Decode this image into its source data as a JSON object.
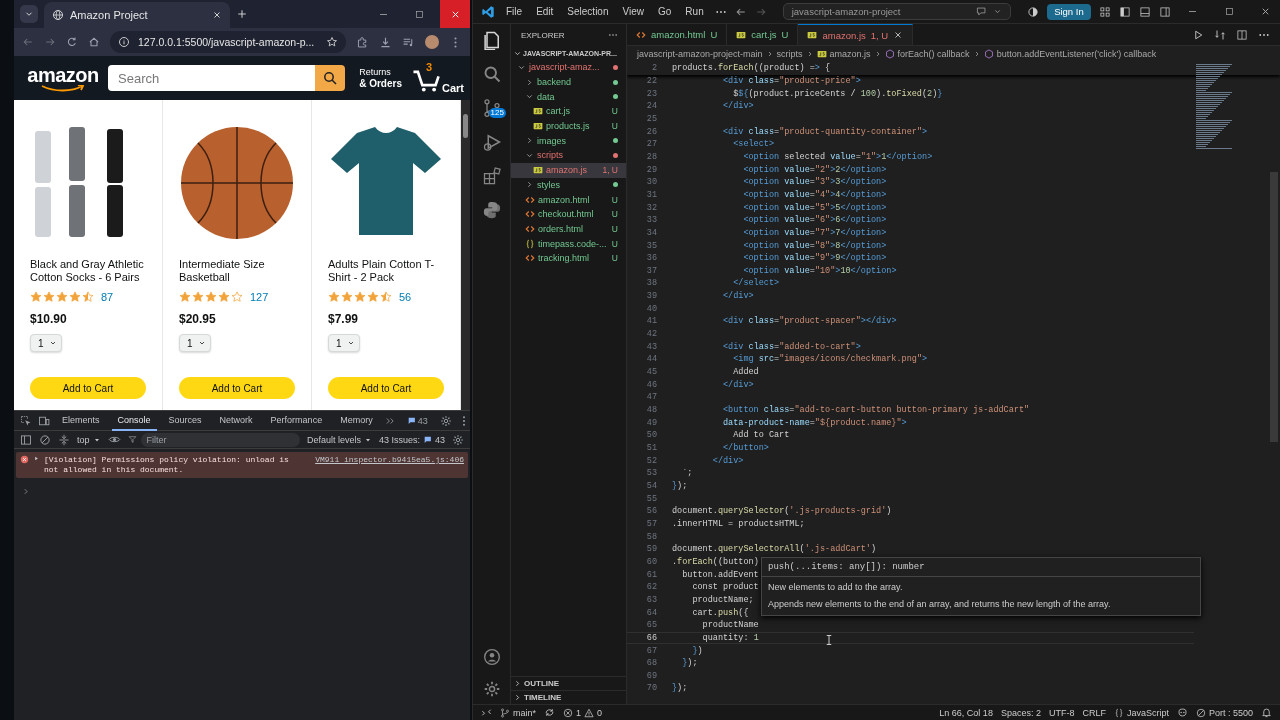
{
  "browser": {
    "tab": {
      "title": "Amazon Project"
    },
    "address": "127.0.0.1:5500/javascript-amazon-p...",
    "site": {
      "logo": "amazon",
      "search": {
        "placeholder": "Search"
      },
      "returns": "Returns",
      "orders": "& Orders",
      "cart_count": "3",
      "cart": "Cart",
      "products": [
        {
          "name": "Black and Gray Athletic Cotton Socks - 6 Pairs",
          "stars": 4.5,
          "rating_count": "87",
          "price": "$10.90",
          "quantity": "1",
          "button": "Add to Cart"
        },
        {
          "name": "Intermediate Size Basketball",
          "stars": 4,
          "rating_count": "127",
          "price": "$20.95",
          "quantity": "1",
          "button": "Add to Cart"
        },
        {
          "name": "Adults Plain Cotton T-Shirt - 2 Pack",
          "stars": 4.5,
          "rating_count": "56",
          "price": "$7.99",
          "quantity": "1",
          "button": "Add to Cart"
        }
      ]
    },
    "devtools": {
      "tabs": [
        {
          "label": "Elements",
          "selected": false
        },
        {
          "label": "Console",
          "selected": true
        },
        {
          "label": "Sources",
          "selected": false
        },
        {
          "label": "Network",
          "selected": false
        },
        {
          "label": "Performance",
          "selected": false
        },
        {
          "label": "Memory",
          "selected": false
        }
      ],
      "issues_badge": "43",
      "context": "top",
      "filter": {
        "placeholder": "Filter"
      },
      "levels": "Default levels",
      "issues": "43 Issues:",
      "issues_count": "43",
      "messages": [
        {
          "text": "[Violation] Permissions policy violation: unload is not allowed in this document.",
          "source": "VM911 inspector.b9415ea5.js:406"
        }
      ]
    }
  },
  "vscode": {
    "menu": [
      "File",
      "Edit",
      "Selection",
      "View",
      "Go",
      "Run"
    ],
    "command_center": "javascript-amazon-project",
    "sign_in": "Sign In",
    "scm_badge": "125",
    "explorer": {
      "title": "EXPLORER",
      "root": "JAVASCRIPT-AMAZON-PR...",
      "tree": [
        {
          "name": "javascript-amaz...",
          "kind": "folder",
          "expanded": true,
          "selected": false,
          "has_errors": true,
          "children": [
            {
              "name": "backend",
              "kind": "folder",
              "expanded": false,
              "selected": false,
              "has_errors": false
            },
            {
              "name": "data",
              "kind": "folder",
              "expanded": true,
              "selected": false,
              "has_errors": false,
              "children": [
                {
                  "name": "cart.js",
                  "kind": "js",
                  "selected": false,
                  "has_errors": false,
                  "badge": "U"
                },
                {
                  "name": "products.js",
                  "kind": "js",
                  "selected": false,
                  "has_errors": false,
                  "badge": "U"
                }
              ]
            },
            {
              "name": "images",
              "kind": "folder",
              "expanded": false,
              "selected": false,
              "has_errors": false
            },
            {
              "name": "scripts",
              "kind": "folder",
              "expanded": true,
              "selected": false,
              "has_errors": true,
              "children": [
                {
                  "name": "amazon.js",
                  "kind": "js",
                  "selected": true,
                  "has_errors": true,
                  "badge": "1, U"
                }
              ]
            },
            {
              "name": "styles",
              "kind": "folder",
              "expanded": false,
              "selected": false,
              "has_errors": false
            },
            {
              "name": "amazon.html",
              "kind": "html",
              "selected": false,
              "has_errors": false,
              "badge": "U"
            },
            {
              "name": "checkout.html",
              "kind": "html",
              "selected": false,
              "has_errors": false,
              "badge": "U"
            },
            {
              "name": "orders.html",
              "kind": "html",
              "selected": false,
              "has_errors": false,
              "badge": "U"
            },
            {
              "name": "timepass.code-...",
              "kind": "json",
              "selected": false,
              "has_errors": false,
              "badge": "U"
            },
            {
              "name": "tracking.html",
              "kind": "html",
              "selected": false,
              "has_errors": false,
              "badge": "U"
            }
          ]
        }
      ],
      "sections": [
        "OUTLINE",
        "TIMELINE"
      ]
    },
    "tabs": [
      {
        "name": "amazon.html",
        "kind": "html",
        "badge": "U",
        "selected": false,
        "has_errors": false
      },
      {
        "name": "cart.js",
        "kind": "js",
        "badge": "U",
        "selected": false,
        "has_errors": false
      },
      {
        "name": "amazon.js",
        "kind": "js",
        "badge": "1, U",
        "selected": true,
        "has_errors": true
      }
    ],
    "breadcrumbs": [
      {
        "label": "javascript-amazon-project-main",
        "kind": "folder"
      },
      {
        "label": "scripts",
        "kind": "folder"
      },
      {
        "label": "amazon.js",
        "kind": "js"
      },
      {
        "label": "forEach() callback",
        "kind": "symbol"
      },
      {
        "label": "button.addEventListener('click') callback",
        "kind": "symbol"
      }
    ],
    "sticky": {
      "number": "2",
      "text": "products.forEach((product) => {"
    },
    "lines": [
      {
        "number": "22",
        "text": "          <div class=\"product-price\">",
        "current": false
      },
      {
        "number": "23",
        "text": "            $${(product.priceCents / 100).toFixed(2)}",
        "current": false
      },
      {
        "number": "24",
        "text": "          </div>",
        "current": false
      },
      {
        "number": "25",
        "current": false
      },
      {
        "number": "26",
        "text": "          <div class=\"product-quantity-container\">",
        "current": false
      },
      {
        "number": "27",
        "text": "            <select>",
        "current": false
      },
      {
        "number": "28",
        "text": "              <option selected value=\"1\">1</option>",
        "current": false
      },
      {
        "number": "29",
        "text": "              <option value=\"2\">2</option>",
        "current": false
      },
      {
        "number": "30",
        "text": "              <option value=\"3\">3</option>",
        "current": false
      },
      {
        "number": "31",
        "text": "              <option value=\"4\">4</option>",
        "current": false
      },
      {
        "number": "32",
        "text": "              <option value=\"5\">5</option>",
        "current": false
      },
      {
        "number": "33",
        "text": "              <option value=\"6\">6</option>",
        "current": false
      },
      {
        "number": "34",
        "text": "              <option value=\"7\">7</option>",
        "current": false
      },
      {
        "number": "35",
        "text": "              <option value=\"8\">8</option>",
        "current": false
      },
      {
        "number": "36",
        "text": "              <option value=\"9\">9</option>",
        "current": false
      },
      {
        "number": "37",
        "text": "              <option value=\"10\">10</option>",
        "current": false
      },
      {
        "number": "38",
        "text": "            </select>",
        "current": false
      },
      {
        "number": "39",
        "text": "          </div>",
        "current": false
      },
      {
        "number": "40",
        "current": false
      },
      {
        "number": "41",
        "text": "          <div class=\"product-spacer\"></div>",
        "current": false
      },
      {
        "number": "42",
        "current": false
      },
      {
        "number": "43",
        "text": "          <div class=\"added-to-cart\">",
        "current": false
      },
      {
        "number": "44",
        "text": "            <img src=\"images/icons/checkmark.png\">",
        "current": false
      },
      {
        "number": "45",
        "text": "            Added",
        "current": false
      },
      {
        "number": "46",
        "text": "          </div>",
        "current": false
      },
      {
        "number": "47",
        "current": false
      },
      {
        "number": "48",
        "text": "          <button class=\"add-to-cart-button button-primary js-addCart\"",
        "current": false
      },
      {
        "number": "49",
        "text": "          data-product-name=\"${product.name}\">",
        "current": false
      },
      {
        "number": "50",
        "text": "            Add to Cart",
        "current": false
      },
      {
        "number": "51",
        "text": "          </button>",
        "current": false
      },
      {
        "number": "52",
        "text": "        </div>",
        "current": false
      },
      {
        "number": "53",
        "text": "  `;",
        "current": false
      },
      {
        "number": "54",
        "text": "});",
        "current": false
      },
      {
        "number": "55",
        "current": false
      },
      {
        "number": "56",
        "text": "document.querySelector('.js-products-grid')",
        "current": false
      },
      {
        "number": "57",
        "text": ".innerHTML = productsHTML;",
        "current": false
      },
      {
        "number": "58",
        "current": false
      },
      {
        "number": "59",
        "text": "document.querySelectorAll('.js-addCart')",
        "current": false
      },
      {
        "number": "60",
        "text": ".forEach((button)",
        "current": false
      },
      {
        "number": "61",
        "text": "  button.addEvent",
        "current": false
      },
      {
        "number": "62",
        "text": "    const product",
        "current": false
      },
      {
        "number": "63",
        "text": "    productName;",
        "current": false
      },
      {
        "number": "64",
        "text": "    cart.push({",
        "current": false
      },
      {
        "number": "65",
        "text": "      productName",
        "current": false
      },
      {
        "number": "66",
        "text": "      quantity: 1",
        "current": true
      },
      {
        "number": "67",
        "text": "    })",
        "current": false
      },
      {
        "number": "68",
        "text": "  });",
        "current": false
      },
      {
        "number": "69",
        "current": false
      },
      {
        "number": "70",
        "text": "});",
        "current": false
      }
    ],
    "hover": {
      "signature": "push(...items: any[]): number",
      "param_doc": "New elements to add to the array.",
      "doc": "Appends new elements to the end of an array, and returns the new length of the array."
    },
    "status": {
      "branch": "main*",
      "errors": "1",
      "warnings": "0",
      "position": "Ln 66, Col 18",
      "spaces": "Spaces: 2",
      "encoding": "UTF-8",
      "eol": "CRLF",
      "language": "JavaScript",
      "port": "Port : 5500"
    }
  }
}
